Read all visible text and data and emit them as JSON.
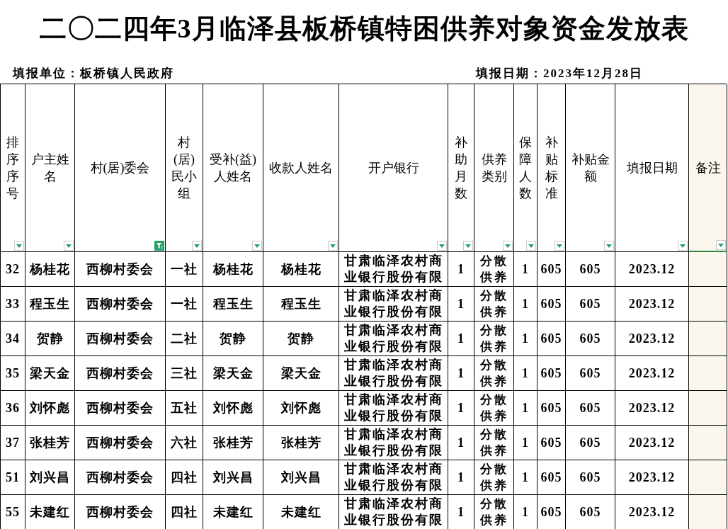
{
  "title": "二〇二四年3月临泽县板桥镇特困供养对象资金发放表",
  "unit_label": "填报单位：板桥镇人民政府",
  "date_label": "填报日期：2023年12月28日",
  "columns": [
    {
      "label": "排序序号",
      "filtered": false,
      "selected": false
    },
    {
      "label": "户主姓名",
      "filtered": false,
      "selected": false
    },
    {
      "label": "村(居)委会",
      "filtered": true,
      "selected": false
    },
    {
      "label": "村(居)民小组",
      "filtered": false,
      "selected": false
    },
    {
      "label": "受补(益)人姓名",
      "filtered": false,
      "selected": false
    },
    {
      "label": "收款人姓名",
      "filtered": false,
      "selected": false
    },
    {
      "label": "开户银行",
      "filtered": false,
      "selected": false
    },
    {
      "label": "补助月数",
      "filtered": false,
      "selected": false
    },
    {
      "label": "供养类别",
      "filtered": false,
      "selected": false
    },
    {
      "label": "保障人数",
      "filtered": false,
      "selected": false
    },
    {
      "label": "补贴标准",
      "filtered": false,
      "selected": false
    },
    {
      "label": "补贴金额",
      "filtered": false,
      "selected": false
    },
    {
      "label": "填报日期",
      "filtered": false,
      "selected": false
    },
    {
      "label": "备注",
      "filtered": false,
      "selected": true
    }
  ],
  "rows": [
    {
      "cells": [
        "32",
        "杨桂花",
        "西柳村委会",
        "一社",
        "杨桂花",
        "杨桂花",
        "甘肃临泽农村商业银行股份有限",
        "1",
        "分散供养",
        "1",
        "605",
        "605",
        "2023.12"
      ]
    },
    {
      "cells": [
        "33",
        "程玉生",
        "西柳村委会",
        "一社",
        "程玉生",
        "程玉生",
        "甘肃临泽农村商业银行股份有限",
        "1",
        "分散供养",
        "1",
        "605",
        "605",
        "2023.12"
      ]
    },
    {
      "cells": [
        "34",
        "贺静",
        "西柳村委会",
        "二社",
        "贺静",
        "贺静",
        "甘肃临泽农村商业银行股份有限",
        "1",
        "分散供养",
        "1",
        "605",
        "605",
        "2023.12"
      ]
    },
    {
      "cells": [
        "35",
        "梁天金",
        "西柳村委会",
        "三社",
        "梁天金",
        "梁天金",
        "甘肃临泽农村商业银行股份有限",
        "1",
        "分散供养",
        "1",
        "605",
        "605",
        "2023.12"
      ]
    },
    {
      "cells": [
        "36",
        "刘怀彪",
        "西柳村委会",
        "五社",
        "刘怀彪",
        "刘怀彪",
        "甘肃临泽农村商业银行股份有限",
        "1",
        "分散供养",
        "1",
        "605",
        "605",
        "2023.12"
      ]
    },
    {
      "cells": [
        "37",
        "张桂芳",
        "西柳村委会",
        "六社",
        "张桂芳",
        "张桂芳",
        "甘肃临泽农村商业银行股份有限",
        "1",
        "分散供养",
        "1",
        "605",
        "605",
        "2023.12"
      ]
    },
    {
      "cells": [
        "51",
        "刘兴昌",
        "西柳村委会",
        "四社",
        "刘兴昌",
        "刘兴昌",
        "甘肃临泽农村商业银行股份有限",
        "1",
        "分散供养",
        "1",
        "605",
        "605",
        "2023.12"
      ]
    },
    {
      "cells": [
        "55",
        "未建红",
        "西柳村委会",
        "四社",
        "未建红",
        "未建红",
        "甘肃临泽农村商业银行股份有限",
        "1",
        "分散供养",
        "1",
        "605",
        "605",
        "2023.12"
      ]
    }
  ]
}
